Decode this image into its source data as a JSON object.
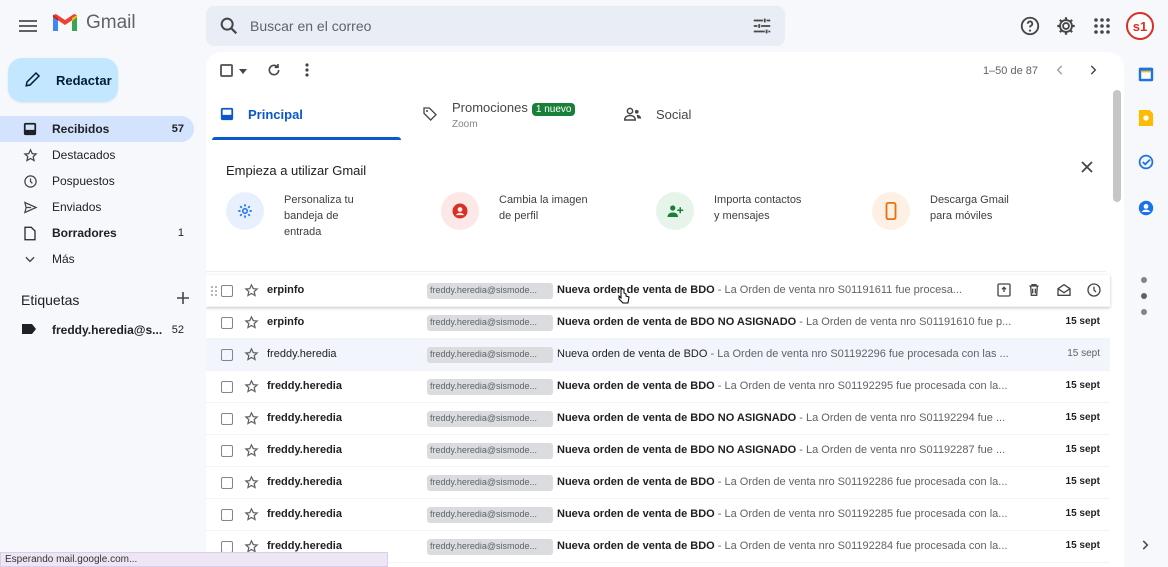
{
  "app": {
    "logo_text": "Gmail",
    "avatar_initials": "s1"
  },
  "search": {
    "placeholder": "Buscar en el correo"
  },
  "compose": {
    "label": "Redactar"
  },
  "nav": {
    "items": [
      {
        "label": "Recibidos",
        "count": "57",
        "icon": "inbox-icon"
      },
      {
        "label": "Destacados",
        "count": "",
        "icon": "star-icon"
      },
      {
        "label": "Pospuestos",
        "count": "",
        "icon": "clock-icon"
      },
      {
        "label": "Enviados",
        "count": "",
        "icon": "send-icon"
      },
      {
        "label": "Borradores",
        "count": "1",
        "icon": "draft-icon"
      },
      {
        "label": "Más",
        "count": "",
        "icon": "chevron-down-icon"
      }
    ]
  },
  "labels": {
    "heading": "Etiquetas",
    "items": [
      {
        "label": "freddy.heredia@s...",
        "count": "52"
      }
    ]
  },
  "toolbar": {
    "pager": "1–50 de 87"
  },
  "tabs": {
    "principal": "Principal",
    "promociones": "Promociones",
    "promociones_badge": "1 nuevo",
    "promociones_sub": "Zoom",
    "social": "Social"
  },
  "onboarding": {
    "title": "Empieza a utilizar Gmail",
    "cards": [
      {
        "line1": "Personaliza tu",
        "line2": "bandeja de",
        "line3": "entrada"
      },
      {
        "line1": "Cambia la imagen",
        "line2": "de perfil",
        "line3": ""
      },
      {
        "line1": "Importa contactos",
        "line2": "y mensajes",
        "line3": ""
      },
      {
        "line1": "Descarga Gmail",
        "line2": "para móviles",
        "line3": ""
      }
    ]
  },
  "emails": [
    {
      "sender": "erpinfo",
      "chip": "freddy.heredia@sismode...",
      "subject": "Nueva orden de venta de BDO",
      "snippet": " - La Orden de venta nro S01191611 fue procesa...",
      "date": ""
    },
    {
      "sender": "erpinfo",
      "chip": "freddy.heredia@sismode...",
      "subject": "Nueva orden de venta de BDO NO ASIGNADO",
      "snippet": " - La Orden de venta nro S01191610 fue p...",
      "date": "15 sept"
    },
    {
      "sender": "freddy.heredia",
      "chip": "freddy.heredia@sismode...",
      "subject": "Nueva orden de venta de BDO",
      "snippet": " - La Orden de venta nro S01192296 fue procesada con las ...",
      "date": "15 sept"
    },
    {
      "sender": "freddy.heredia",
      "chip": "freddy.heredia@sismode...",
      "subject": "Nueva orden de venta de BDO",
      "snippet": " - La Orden de venta nro S01192295 fue procesada con la...",
      "date": "15 sept"
    },
    {
      "sender": "freddy.heredia",
      "chip": "freddy.heredia@sismode...",
      "subject": "Nueva orden de venta de BDO NO ASIGNADO",
      "snippet": " - La Orden de venta nro S01192294 fue ...",
      "date": "15 sept"
    },
    {
      "sender": "freddy.heredia",
      "chip": "freddy.heredia@sismode...",
      "subject": "Nueva orden de venta de BDO NO ASIGNADO",
      "snippet": " - La Orden de venta nro S01192287 fue ...",
      "date": "15 sept"
    },
    {
      "sender": "freddy.heredia",
      "chip": "freddy.heredia@sismode...",
      "subject": "Nueva orden de venta de BDO",
      "snippet": " - La Orden de venta nro S01192286 fue procesada con la...",
      "date": "15 sept"
    },
    {
      "sender": "freddy.heredia",
      "chip": "freddy.heredia@sismode...",
      "subject": "Nueva orden de venta de BDO",
      "snippet": " - La Orden de venta nro S01192285 fue procesada con la...",
      "date": "15 sept"
    },
    {
      "sender": "freddy.heredia",
      "chip": "freddy.heredia@sismode...",
      "subject": "Nueva orden de venta de BDO",
      "snippet": " - La Orden de venta nro S01192284 fue procesada con la...",
      "date": "15 sept"
    }
  ],
  "status_bar": "Esperando mail.google.com...",
  "colors": {
    "accent": "#0b57d0",
    "compose_bg": "#c2e7ff",
    "nav_active": "#d3e3fd",
    "badge": "#188038"
  }
}
